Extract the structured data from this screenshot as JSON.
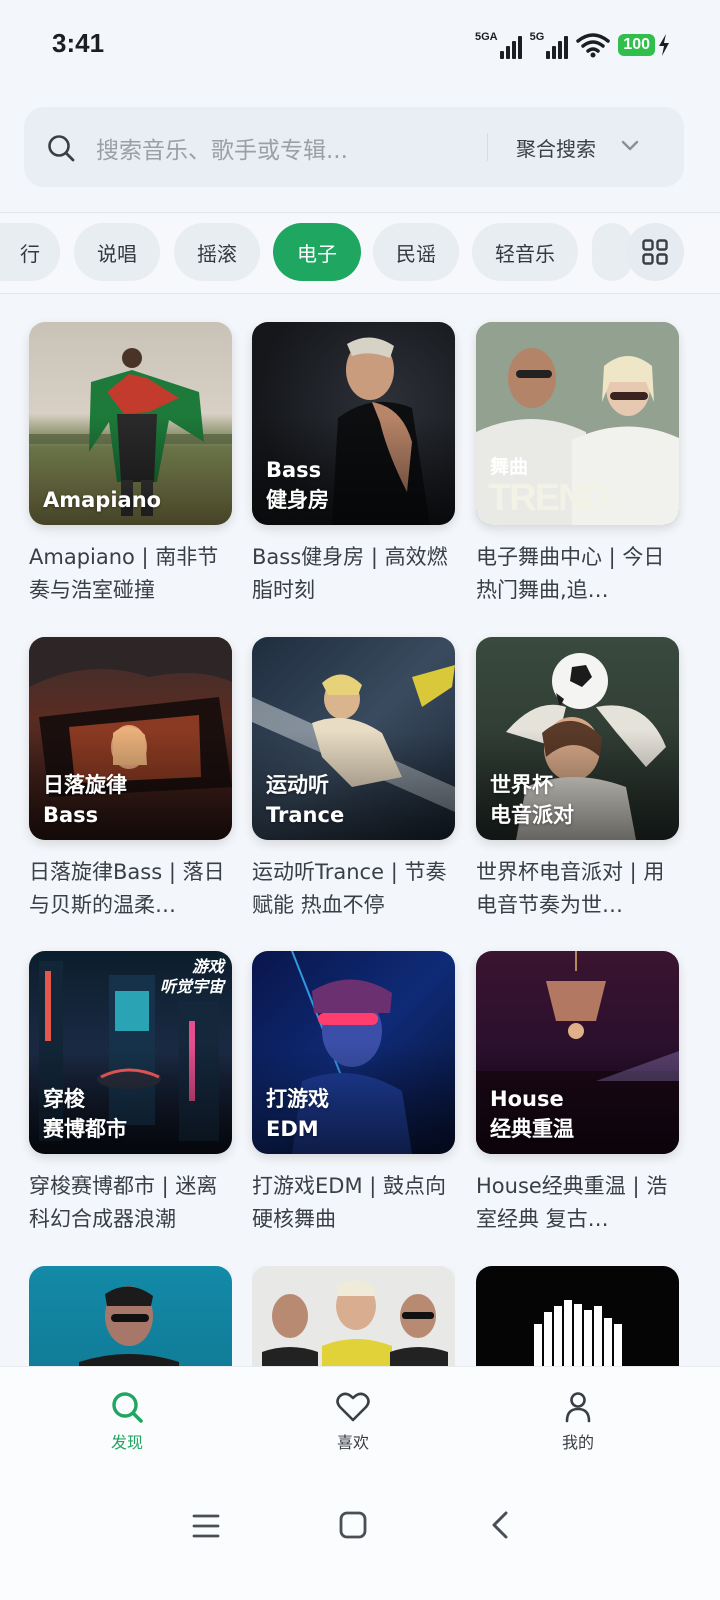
{
  "status_bar": {
    "time": "3:41",
    "network1": "5GA",
    "network2": "5G",
    "battery": "100"
  },
  "search": {
    "placeholder": "搜索音乐、歌手或专辑...",
    "mode": "聚合搜索"
  },
  "genres": [
    {
      "label": "行",
      "active": false
    },
    {
      "label": "说唱",
      "active": false
    },
    {
      "label": "摇滚",
      "active": false
    },
    {
      "label": "电子",
      "active": true
    },
    {
      "label": "民谣",
      "active": false
    },
    {
      "label": "轻音乐",
      "active": false
    }
  ],
  "playlists": [
    {
      "cover_label": "Amapiano",
      "title": "Amapiano | 南非节奏与浩室碰撞"
    },
    {
      "cover_label": "Bass\n健身房",
      "title": "Bass健身房 | 高效燃脂时刻"
    },
    {
      "cover_label_small": "舞曲",
      "cover_label_big": "TREND",
      "title": "电子舞曲中心 | 今日热门舞曲,追…"
    },
    {
      "cover_label": "日落旋律\nBass",
      "title": "日落旋律Bass | 落日与贝斯的温柔…"
    },
    {
      "cover_label": "运动听\nTrance",
      "title": "运动听Trance | 节奏赋能 热血不停"
    },
    {
      "cover_label": "世界杯\n电音派对",
      "title": "世界杯电音派对 | 用电音节奏为世…"
    },
    {
      "cover_label": "穿梭\n赛博都市",
      "cover_tag": "游戏\n听觉宇宙",
      "title": "穿梭赛博都市 | 迷离科幻合成器浪潮"
    },
    {
      "cover_label": "打游戏\nEDM",
      "title": "打游戏EDM | 鼓点向硬核舞曲"
    },
    {
      "cover_label": "House\n经典重温",
      "title": "House经典重温 | 浩室经典 复古…"
    }
  ],
  "nav": {
    "discover": "发现",
    "favorites": "喜欢",
    "mine": "我的"
  },
  "colors": {
    "accent": "#1fa660",
    "background": "#f3f6fa"
  }
}
